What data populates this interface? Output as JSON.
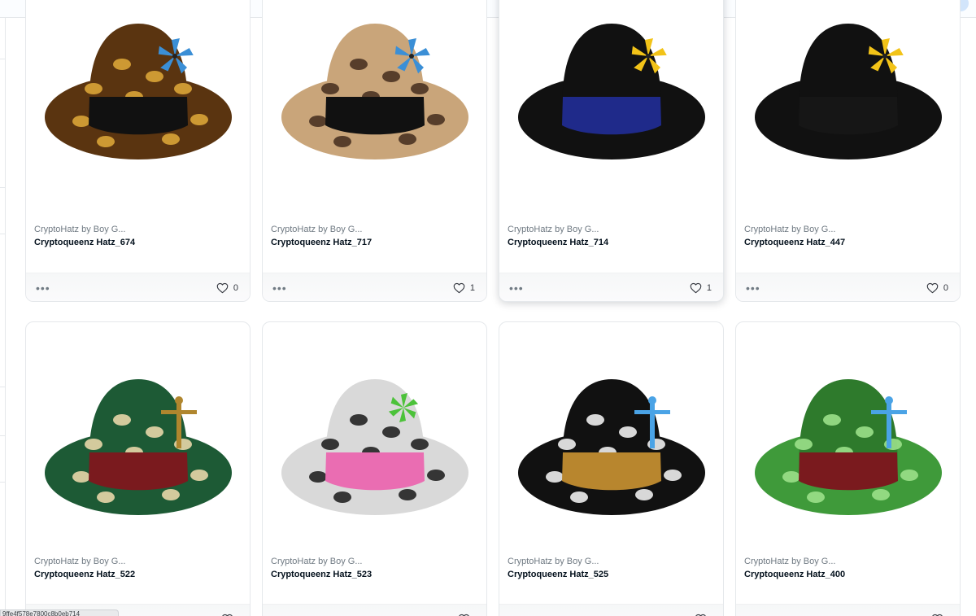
{
  "status_bar": {
    "url_fragment": "9ffe4f578e7800c8b0eb714"
  },
  "icons": {
    "more": "more-horizontal-icon",
    "like": "heart-outline-icon"
  },
  "colors": {
    "primary_button": "#d2e5fb",
    "border": "#e5e8eb",
    "muted_text": "#707a83"
  },
  "cards": [
    {
      "collection": "CryptoHatz by Boy G...",
      "title": "Cryptoqueenz Hatz_674",
      "more": "•••",
      "likes": "0",
      "hat": "hat-brown-dotted"
    },
    {
      "collection": "CryptoHatz by Boy G...",
      "title": "Cryptoqueenz Hatz_717",
      "more": "•••",
      "likes": "1",
      "hat": "hat-leopard"
    },
    {
      "collection": "CryptoHatz by Boy G...",
      "title": "Cryptoqueenz Hatz_714",
      "more": "•••",
      "likes": "1",
      "hat": "hat-black-blue-band"
    },
    {
      "collection": "CryptoHatz by Boy G...",
      "title": "Cryptoqueenz Hatz_447",
      "more": "•••",
      "likes": "0",
      "hat": "hat-black"
    },
    {
      "collection": "CryptoHatz by Boy G...",
      "title": "Cryptoqueenz Hatz_522",
      "more": "•••",
      "likes": "",
      "hat": "hat-green-stars"
    },
    {
      "collection": "CryptoHatz by Boy G...",
      "title": "Cryptoqueenz Hatz_523",
      "more": "•••",
      "likes": "",
      "hat": "hat-cow-pink-band"
    },
    {
      "collection": "CryptoHatz by Boy G...",
      "title": "Cryptoqueenz Hatz_525",
      "more": "•••",
      "likes": "",
      "hat": "hat-black-safety-pins"
    },
    {
      "collection": "CryptoHatz by Boy G...",
      "title": "Cryptoqueenz Hatz_400",
      "more": "•••",
      "likes": "",
      "hat": "hat-green-pattern"
    }
  ]
}
